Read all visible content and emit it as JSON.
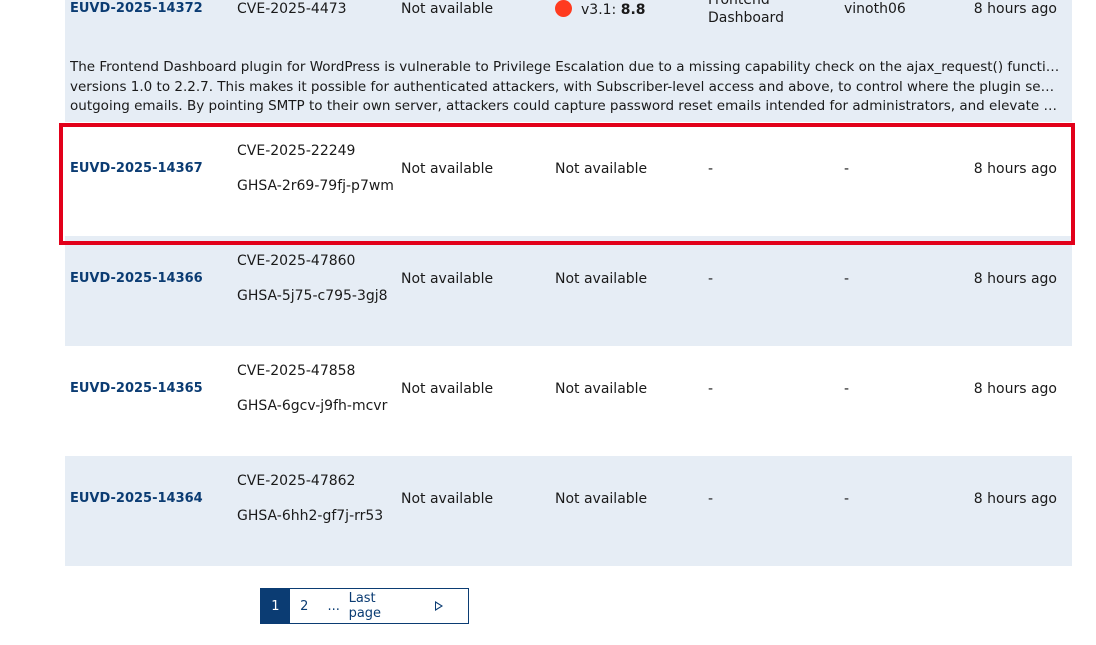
{
  "rows": [
    {
      "euvd_id": "EUVD-2025-14372",
      "aliases": [
        "CVE-2025-4473"
      ],
      "epss": "Not available",
      "score": {
        "version": "v3.1:",
        "value": "8.8",
        "color": "#ff3b1f"
      },
      "product": [
        "Frontend",
        "Dashboard"
      ],
      "vendor": "vinoth06",
      "updated": "8 hours ago",
      "description": [
        "The Frontend Dashboard plugin for WordPress is vulnerable to Privilege Escalation due to a missing capability check on the ajax_request() function in",
        "versions 1.0 to 2.2.7. This makes it possible for authenticated attackers, with Subscriber-level access and above, to control where the plugin sends",
        "outgoing emails. By pointing SMTP to their own server, attackers could capture password reset emails intended for administrators, and elevate their…"
      ]
    },
    {
      "euvd_id": "EUVD-2025-14367",
      "aliases": [
        "CVE-2025-22249",
        "GHSA-2r69-79fj-p7wm"
      ],
      "epss": "Not available",
      "score_text": "Not available",
      "product_text": "-",
      "vendor": "-",
      "updated": "8 hours ago"
    },
    {
      "euvd_id": "EUVD-2025-14366",
      "aliases": [
        "CVE-2025-47860",
        "GHSA-5j75-c795-3gj8"
      ],
      "epss": "Not available",
      "score_text": "Not available",
      "product_text": "-",
      "vendor": "-",
      "updated": "8 hours ago"
    },
    {
      "euvd_id": "EUVD-2025-14365",
      "aliases": [
        "CVE-2025-47858",
        "GHSA-6gcv-j9fh-mcvr"
      ],
      "epss": "Not available",
      "score_text": "Not available",
      "product_text": "-",
      "vendor": "-",
      "updated": "8 hours ago"
    },
    {
      "euvd_id": "EUVD-2025-14364",
      "aliases": [
        "CVE-2025-47862",
        "GHSA-6hh2-gf7j-rr53"
      ],
      "epss": "Not available",
      "score_text": "Not available",
      "product_text": "-",
      "vendor": "-",
      "updated": "8 hours ago"
    }
  ],
  "highlight_color": "#e2001a",
  "accent_color": "#0b3c73",
  "pagination": {
    "current": "1",
    "next_page": "2",
    "ellipsis": "...",
    "last_label": "Last page",
    "next_icon": "next-triangle-icon"
  }
}
